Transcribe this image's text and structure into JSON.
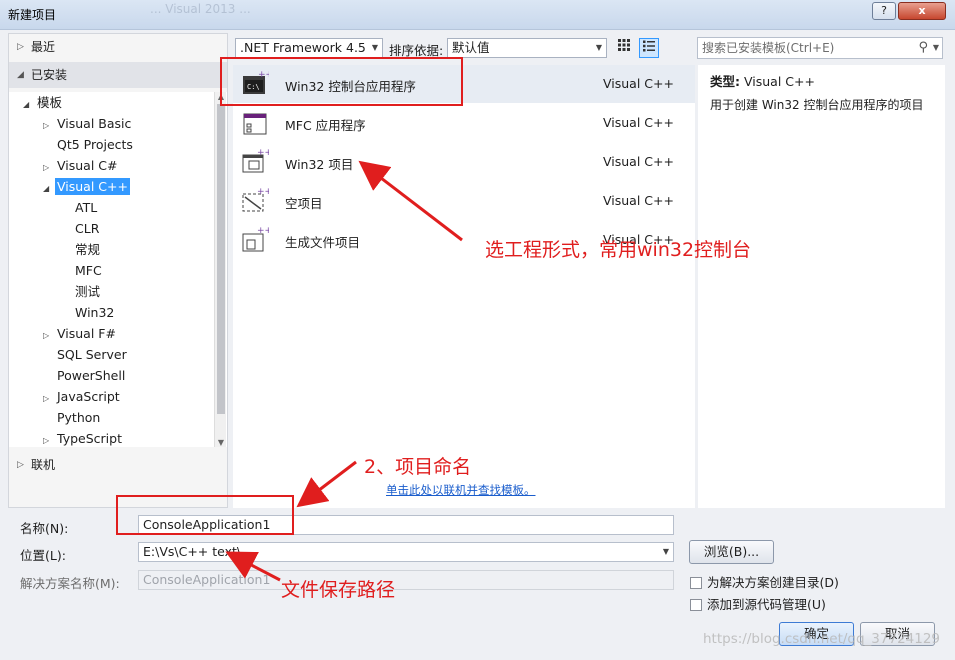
{
  "window": {
    "title": "新建项目",
    "ghost_title": "... Visual 2013 ...",
    "help_label": "?",
    "close_label": "x"
  },
  "left_pane": {
    "recent": "最近",
    "installed": "已安装",
    "online": "联机",
    "tree": [
      {
        "label": "模板",
        "depth": 0,
        "arrow": "◢"
      },
      {
        "label": "Visual Basic",
        "depth": 1,
        "arrow": "▷"
      },
      {
        "label": "Qt5 Projects",
        "depth": 1,
        "arrow": ""
      },
      {
        "label": "Visual C#",
        "depth": 1,
        "arrow": "▷"
      },
      {
        "label": "Visual C++",
        "depth": 1,
        "arrow": "◢",
        "selected": true
      },
      {
        "label": "ATL",
        "depth": 2,
        "arrow": ""
      },
      {
        "label": "CLR",
        "depth": 2,
        "arrow": ""
      },
      {
        "label": "常规",
        "depth": 2,
        "arrow": ""
      },
      {
        "label": "MFC",
        "depth": 2,
        "arrow": ""
      },
      {
        "label": "测试",
        "depth": 2,
        "arrow": ""
      },
      {
        "label": "Win32",
        "depth": 2,
        "arrow": ""
      },
      {
        "label": "Visual F#",
        "depth": 1,
        "arrow": "▷"
      },
      {
        "label": "SQL Server",
        "depth": 1,
        "arrow": ""
      },
      {
        "label": "PowerShell",
        "depth": 1,
        "arrow": ""
      },
      {
        "label": "JavaScript",
        "depth": 1,
        "arrow": "▷"
      },
      {
        "label": "Python",
        "depth": 1,
        "arrow": ""
      },
      {
        "label": "TypeScript",
        "depth": 1,
        "arrow": "▷"
      }
    ]
  },
  "toolbar": {
    "framework": ".NET Framework 4.5",
    "sort_label": "排序依据:",
    "sort_value": "默认值",
    "search_placeholder": "搜索已安装模板(Ctrl+E)"
  },
  "templates": [
    {
      "name": "Win32 控制台应用程序",
      "lang": "Visual C++",
      "icon": "console-app-icon",
      "selected": true
    },
    {
      "name": "MFC 应用程序",
      "lang": "Visual C++",
      "icon": "mfc-app-icon"
    },
    {
      "name": "Win32 项目",
      "lang": "Visual C++",
      "icon": "win32-project-icon"
    },
    {
      "name": "空项目",
      "lang": "Visual C++",
      "icon": "empty-project-icon"
    },
    {
      "name": "生成文件项目",
      "lang": "Visual C++",
      "icon": "makefile-project-icon"
    }
  ],
  "online_link": "单击此处以联机并查找模板。",
  "description": {
    "type_label": "类型:",
    "type_value": "Visual C++",
    "text": "用于创建 Win32 控制台应用程序的项目"
  },
  "form": {
    "name_label": "名称(N):",
    "name_value": "ConsoleApplication1",
    "location_label": "位置(L):",
    "location_value": "E:\\Vs\\C++ text\\",
    "solution_label": "解决方案名称(M):",
    "solution_value": "ConsoleApplication1",
    "browse_label": "浏览(B)...",
    "create_dir_label": "为解决方案创建目录(D)",
    "add_source_label": "添加到源代码管理(U)",
    "ok_label": "确定",
    "cancel_label": "取消"
  },
  "annotations": {
    "select_form": "选工程形式，常用win32控制台",
    "name_step": "2、项目命名",
    "save_path": "文件保存路径"
  },
  "watermark": "https://blog.csdn.net/qq_37724129",
  "colors": {
    "annotation_red": "#e01e1e",
    "selection_blue": "#3399ff",
    "link_blue": "#1a5dcc"
  }
}
